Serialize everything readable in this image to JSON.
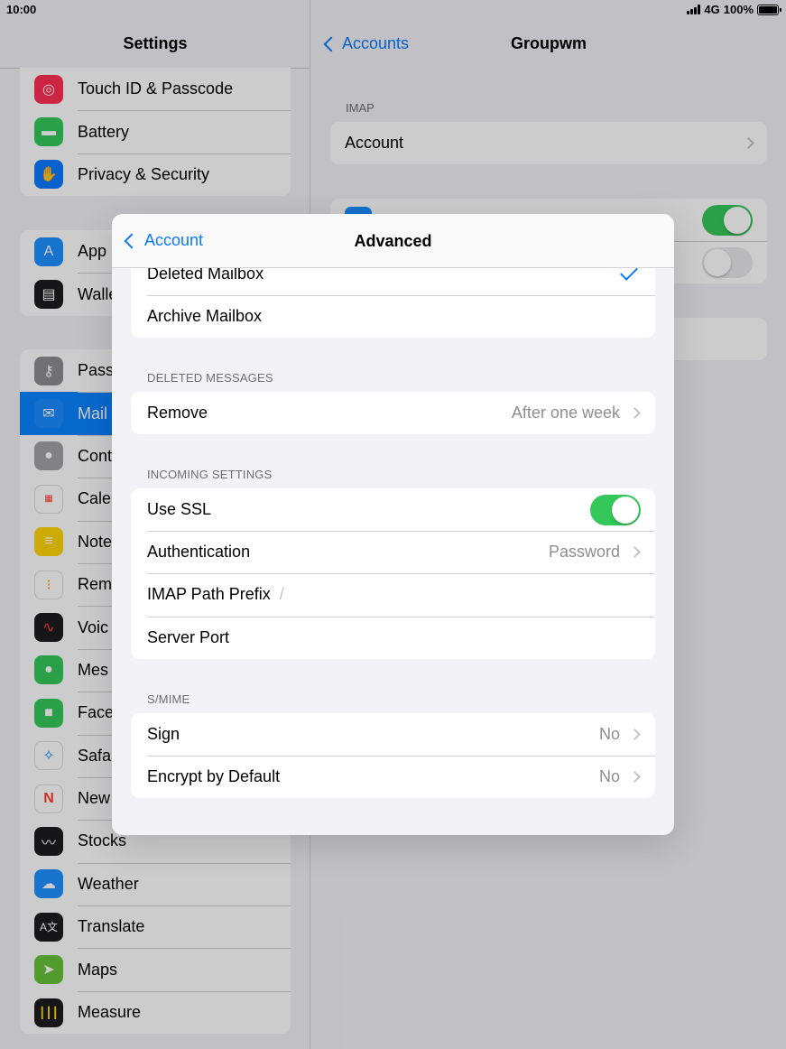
{
  "status_bar": {
    "time": "10:00",
    "network": "4G",
    "battery": "100%"
  },
  "sidebar": {
    "title": "Settings",
    "groups": [
      [
        {
          "label": "Touch ID & Passcode",
          "icon": "fingerprint-icon",
          "color": "#ff2d55"
        },
        {
          "label": "Battery",
          "icon": "battery-icon",
          "color": "#34c759"
        },
        {
          "label": "Privacy & Security",
          "icon": "hand-icon",
          "color": "#0a7aff"
        }
      ],
      [
        {
          "label": "App",
          "icon": "app-store-icon",
          "color": "#1e90ff"
        },
        {
          "label": "Walle",
          "icon": "wallet-icon",
          "color": "#1c1c1e"
        }
      ],
      [
        {
          "label": "Pass",
          "icon": "key-icon",
          "color": "#8e8e93"
        },
        {
          "label": "Mail",
          "icon": "mail-icon",
          "color": "#1a8cff"
        },
        {
          "label": "Cont",
          "icon": "contacts-icon",
          "color": "#a2a2a7"
        },
        {
          "label": "Cale",
          "icon": "calendar-icon",
          "color": "#ffffff"
        },
        {
          "label": "Note",
          "icon": "notes-icon",
          "color": "#ffd60a"
        },
        {
          "label": "Rem",
          "icon": "reminders-icon",
          "color": "#ffffff"
        },
        {
          "label": "Voic",
          "icon": "voice-memos-icon",
          "color": "#1c1c1e"
        },
        {
          "label": "Mes",
          "icon": "messages-icon",
          "color": "#34c759"
        },
        {
          "label": "Face",
          "icon": "facetime-icon",
          "color": "#34c759"
        },
        {
          "label": "Safa",
          "icon": "safari-icon",
          "color": "#0a84ff"
        },
        {
          "label": "New",
          "icon": "news-icon",
          "color": "#ff3b30"
        },
        {
          "label": "Stocks",
          "icon": "stocks-icon",
          "color": "#1c1c1e"
        },
        {
          "label": "Weather",
          "icon": "weather-icon",
          "color": "#1e90ff"
        },
        {
          "label": "Translate",
          "icon": "translate-icon",
          "color": "#1c1c1e"
        },
        {
          "label": "Maps",
          "icon": "maps-icon",
          "color": "#67c23a"
        },
        {
          "label": "Measure",
          "icon": "measure-icon",
          "color": "#1c1c1e"
        }
      ]
    ]
  },
  "detail": {
    "back_label": "Accounts",
    "title": "Groupwm",
    "section_header": "IMAP",
    "account_row": "Account"
  },
  "modal": {
    "back_label": "Account",
    "title": "Advanced",
    "mailbox_rows": {
      "deleted": "Deleted Mailbox",
      "archive": "Archive Mailbox"
    },
    "deleted_messages": {
      "header": "DELETED MESSAGES",
      "remove_label": "Remove",
      "remove_value": "After one week"
    },
    "incoming": {
      "header": "INCOMING SETTINGS",
      "use_ssl": "Use SSL",
      "use_ssl_on": true,
      "auth_label": "Authentication",
      "auth_value": "Password",
      "imap_prefix_label": "IMAP Path Prefix",
      "imap_prefix_placeholder": "/",
      "server_port_label": "Server Port"
    },
    "smime": {
      "header": "S/MIME",
      "sign_label": "Sign",
      "sign_value": "No",
      "encrypt_label": "Encrypt by Default",
      "encrypt_value": "No"
    }
  },
  "colors": {
    "accent": "#0a7aff",
    "toggle_on": "#34c759"
  }
}
